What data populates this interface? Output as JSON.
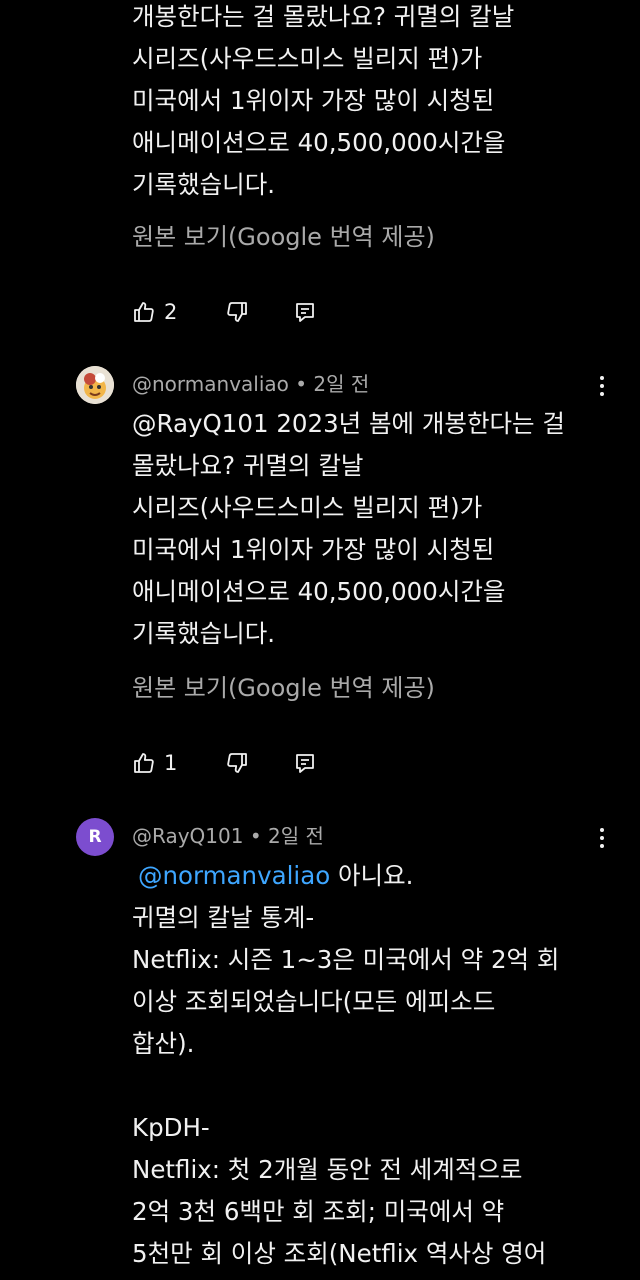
{
  "comments": [
    {
      "text": "개봉한다는 걸 몰랐나요? 귀멸의 칼날\n시리즈(사우드스미스 빌리지 편)가\n미국에서 1위이자 가장 많이 시청된\n애니메이션으로 40,500,000시간을\n기록했습니다.",
      "translate_label": "원본 보기(Google 번역 제공)",
      "likes": "2"
    },
    {
      "author": "@normanvaliao",
      "time": "• 2일 전",
      "text": "@RayQ101 2023년 봄에 개봉한다는 걸\n몰랐나요? 귀멸의 칼날\n시리즈(사우드스미스 빌리지 편)가\n미국에서 1위이자 가장 많이 시청된\n애니메이션으로 40,500,000시간을\n기록했습니다.",
      "translate_label": "원본 보기(Google 번역 제공)",
      "likes": "1"
    },
    {
      "author": "@RayQ101",
      "time": "• 2일 전",
      "avatar_letter": "R",
      "mention": "@normanvaliao",
      "mention_after": " 아니요.",
      "text": "귀멸의 칼날 통계-\nNetflix: 시즌 1~3은 미국에서 약 2억 회\n이상 조회되었습니다(모든 에피소드\n합산).\n\nKpDH-\nNetflix: 첫 2개월 동안 전 세계적으로\n2억 3천 6백만 회 조회; 미국에서 약\n5천만 회 이상 조회(Netflix 역사상 영어"
    }
  ],
  "colors": {
    "background": "#000000",
    "text": "#f1f1f1",
    "secondary": "#aaaaaa",
    "mention": "#3ea6ff",
    "avatar_r": "#7c4dcf"
  },
  "icons": [
    "like-icon",
    "dislike-icon",
    "reply-icon",
    "more-vert-icon"
  ]
}
